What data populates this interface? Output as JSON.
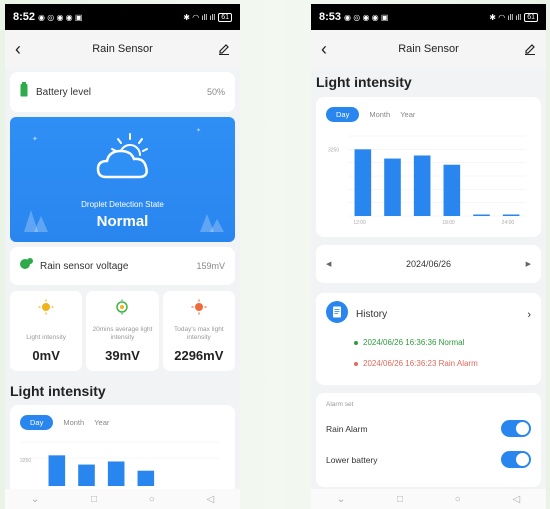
{
  "left": {
    "status": {
      "time": "8:52",
      "battery": "61"
    },
    "nav": {
      "title": "Rain Sensor"
    },
    "battery": {
      "label": "Battery level",
      "value": "50%"
    },
    "hero": {
      "state_label": "Droplet Detection State",
      "status": "Normal"
    },
    "voltage": {
      "label": "Rain sensor voltage",
      "value": "159mV"
    },
    "tiles": [
      {
        "label": "Light intensity",
        "value": "0mV",
        "icon": "sun-icon"
      },
      {
        "label": "20mins average light intensity",
        "value": "39mV",
        "icon": "sun-timer-icon"
      },
      {
        "label": "Today's max light intensity",
        "value": "2296mV",
        "icon": "sun-max-icon"
      }
    ],
    "light": {
      "title": "Light intensity",
      "tabs": [
        "Day",
        "Month",
        "Year"
      ],
      "ytick": "3250"
    }
  },
  "right": {
    "status": {
      "time": "8:53",
      "battery": "61"
    },
    "nav": {
      "title": "Rain Sensor"
    },
    "light": {
      "title": "Light intensity",
      "tabs": [
        "Day",
        "Month",
        "Year"
      ]
    },
    "date": "2024/06/26",
    "history": {
      "title": "History",
      "entries": [
        {
          "text": "2024/06/26 16:36:36 Normal",
          "color": "#2e9b3e"
        },
        {
          "text": "2024/06/26 16:36:23 Rain Alarm",
          "color": "#e06a5c"
        }
      ]
    },
    "alarm": {
      "title": "Alarm set",
      "items": [
        {
          "label": "Rain Alarm",
          "on": true
        },
        {
          "label": "Lower battery",
          "on": true
        }
      ]
    }
  },
  "chart_data": {
    "type": "bar",
    "x": [
      "12:00",
      "14:00",
      "16:00",
      "18:00",
      "20:00",
      "22:00"
    ],
    "values": [
      3250,
      2800,
      2950,
      2500,
      40,
      40
    ],
    "xtick_labels": [
      "12:00",
      "",
      "",
      "18:00",
      "",
      "24:00"
    ],
    "yticks": [
      "",
      "3250",
      "",
      "",
      "",
      ""
    ],
    "ylim": [
      0,
      3900
    ],
    "grid": true,
    "color": "#2a86ef"
  }
}
